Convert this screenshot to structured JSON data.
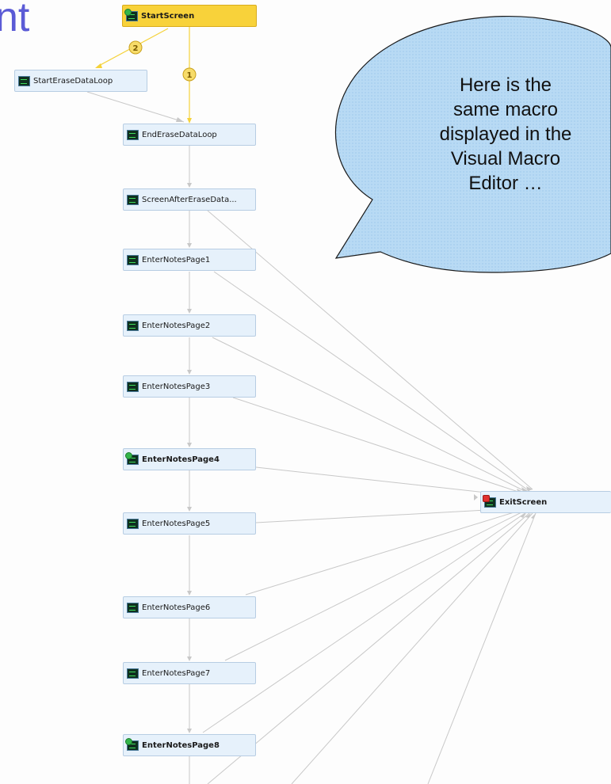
{
  "header": {
    "title_fragment": "nt"
  },
  "nodes": [
    {
      "id": "start",
      "label": "StartScreen",
      "style": "start",
      "icon": "green-dot-screen-icon"
    },
    {
      "id": "sel",
      "label": "StartEraseDataLoop",
      "style": "normal",
      "icon": "screen-icon"
    },
    {
      "id": "eel",
      "label": "EndEraseDataLoop",
      "style": "normal",
      "icon": "screen-icon"
    },
    {
      "id": "saed",
      "label": "ScreenAfterEraseData...",
      "style": "normal",
      "icon": "screen-icon"
    },
    {
      "id": "p1",
      "label": "EnterNotesPage1",
      "style": "normal",
      "icon": "screen-icon"
    },
    {
      "id": "p2",
      "label": "EnterNotesPage2",
      "style": "normal",
      "icon": "screen-icon"
    },
    {
      "id": "p3",
      "label": "EnterNotesPage3",
      "style": "normal",
      "icon": "screen-icon"
    },
    {
      "id": "p4",
      "label": "EnterNotesPage4",
      "style": "bold",
      "icon": "green-dot-screen-icon"
    },
    {
      "id": "p5",
      "label": "EnterNotesPage5",
      "style": "normal",
      "icon": "screen-icon"
    },
    {
      "id": "p6",
      "label": "EnterNotesPage6",
      "style": "normal",
      "icon": "screen-icon"
    },
    {
      "id": "p7",
      "label": "EnterNotesPage7",
      "style": "normal",
      "icon": "screen-icon"
    },
    {
      "id": "p8",
      "label": "EnterNotesPage8",
      "style": "bold",
      "icon": "green-dot-screen-icon"
    },
    {
      "id": "exit",
      "label": "ExitScreen",
      "style": "bold",
      "icon": "red-dot-screen-icon"
    }
  ],
  "edge_labels": {
    "start_to_sel": "2",
    "start_to_eel": "1"
  },
  "callout": {
    "text": "Here is the\nsame macro\ndisplayed in the\nVisual Macro\nEditor …"
  },
  "colors": {
    "start_node": "#f8d23a",
    "node_fill": "#e6f1fb",
    "node_border": "#b7cde3",
    "yellow_edge": "#f5d23a",
    "gray_edge": "#c8c8c8",
    "callout_fill": "#b3d6f2",
    "title_color": "#5b5bd6"
  }
}
